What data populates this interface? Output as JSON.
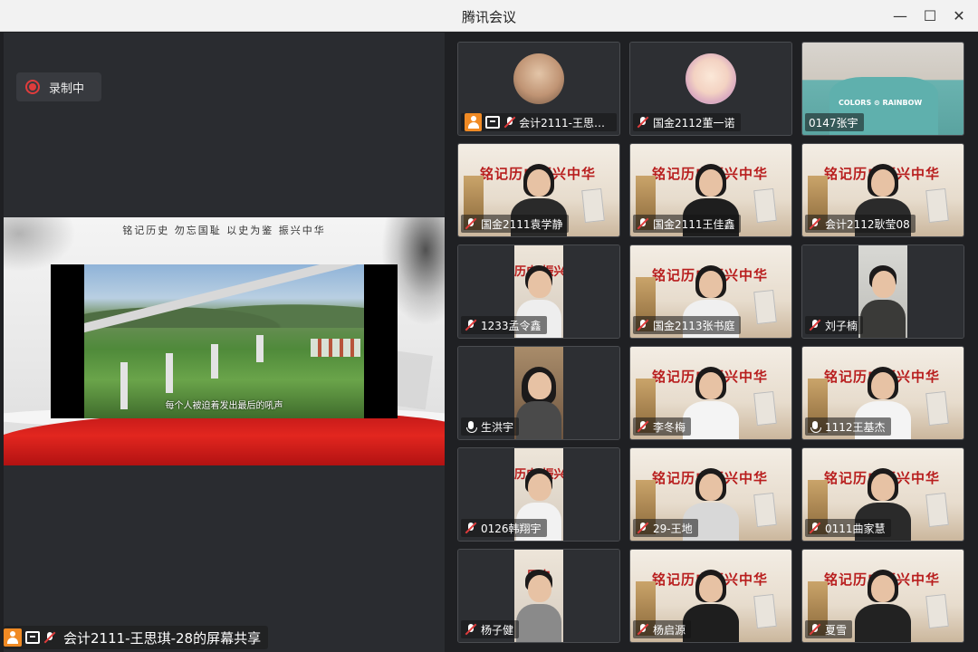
{
  "window": {
    "title": "腾讯会议",
    "min_glyph": "—",
    "max_glyph": "☐",
    "close_glyph": "✕"
  },
  "recording": {
    "label": "录制中",
    "color": "#e03c3c"
  },
  "share": {
    "slide_header": "铭记历史  勿忘国耻  以史为鉴  振兴中华",
    "subtitle": "每个人被迫着发出最后的吼声",
    "sharer_label": "会计2111-王思琪-28的屏幕共享"
  },
  "banner_text": "铭记历史振兴中华",
  "banner_partial_1": "历史 振兴",
  "banner_partial_2": "历史 振兴",
  "banner_partial_3": "历史",
  "participants": [
    {
      "name": "会计2111-王思琪...",
      "host": true,
      "sharing": true,
      "mic": "off",
      "bg": "avatar"
    },
    {
      "name": "国金2112董一诺",
      "mic": "off",
      "bg": "avatar-cartoon"
    },
    {
      "name": "0147张宇",
      "mic": "none",
      "bg": "photo",
      "shirt_text": "COLORS ⊙ RAINBOW"
    },
    {
      "name": "国金2111袁学静",
      "mic": "off",
      "bg": "banner"
    },
    {
      "name": "国金2111王佳鑫",
      "mic": "off",
      "bg": "banner"
    },
    {
      "name": "会计2112耿莹08",
      "mic": "off",
      "bg": "banner"
    },
    {
      "name": "1233孟令鑫",
      "mic": "off",
      "bg": "portrait-banner"
    },
    {
      "name": "国金2113张书庭",
      "mic": "off",
      "bg": "banner"
    },
    {
      "name": "刘子楠",
      "mic": "off",
      "bg": "portrait-office"
    },
    {
      "name": "生洪宇",
      "mic": "on",
      "bg": "portrait-room"
    },
    {
      "name": "李冬梅",
      "mic": "off",
      "bg": "banner"
    },
    {
      "name": "1112王基杰",
      "mic": "on",
      "bg": "banner"
    },
    {
      "name": "0126韩翔宇",
      "mic": "off",
      "bg": "portrait-banner2"
    },
    {
      "name": "29-王地",
      "mic": "off",
      "bg": "banner"
    },
    {
      "name": "0111曲家慧",
      "mic": "off",
      "bg": "banner"
    },
    {
      "name": "杨子健",
      "mic": "off",
      "bg": "portrait-banner3"
    },
    {
      "name": "杨启源",
      "mic": "off",
      "bg": "banner"
    },
    {
      "name": "夏雪",
      "mic": "off",
      "bg": "banner"
    }
  ]
}
